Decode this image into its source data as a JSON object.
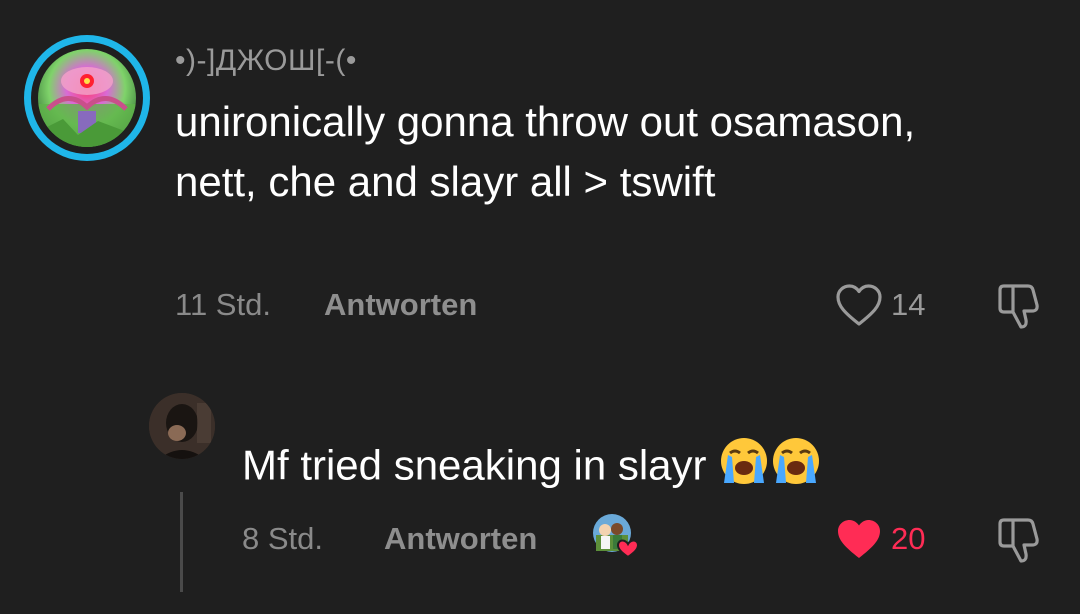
{
  "comment": {
    "username": "•)-]ДЖОШ[-(•",
    "text": "unironically gonna throw out osamason, nett, che and slayr all > tswift",
    "time": "11 Std.",
    "reply_label": "Antworten",
    "like_count": "14",
    "liked": false
  },
  "reply": {
    "text": "Mf tried sneaking in slayr",
    "emoji": "loudly-crying-face",
    "time": "8 Std.",
    "reply_label": "Antworten",
    "like_count": "20",
    "liked": true,
    "creator_liked": true
  },
  "colors": {
    "background": "#1f1f1f",
    "story_ring": "#1fb6e9",
    "liked_heart": "#ff2c55",
    "muted_text": "#8a8a8a"
  }
}
